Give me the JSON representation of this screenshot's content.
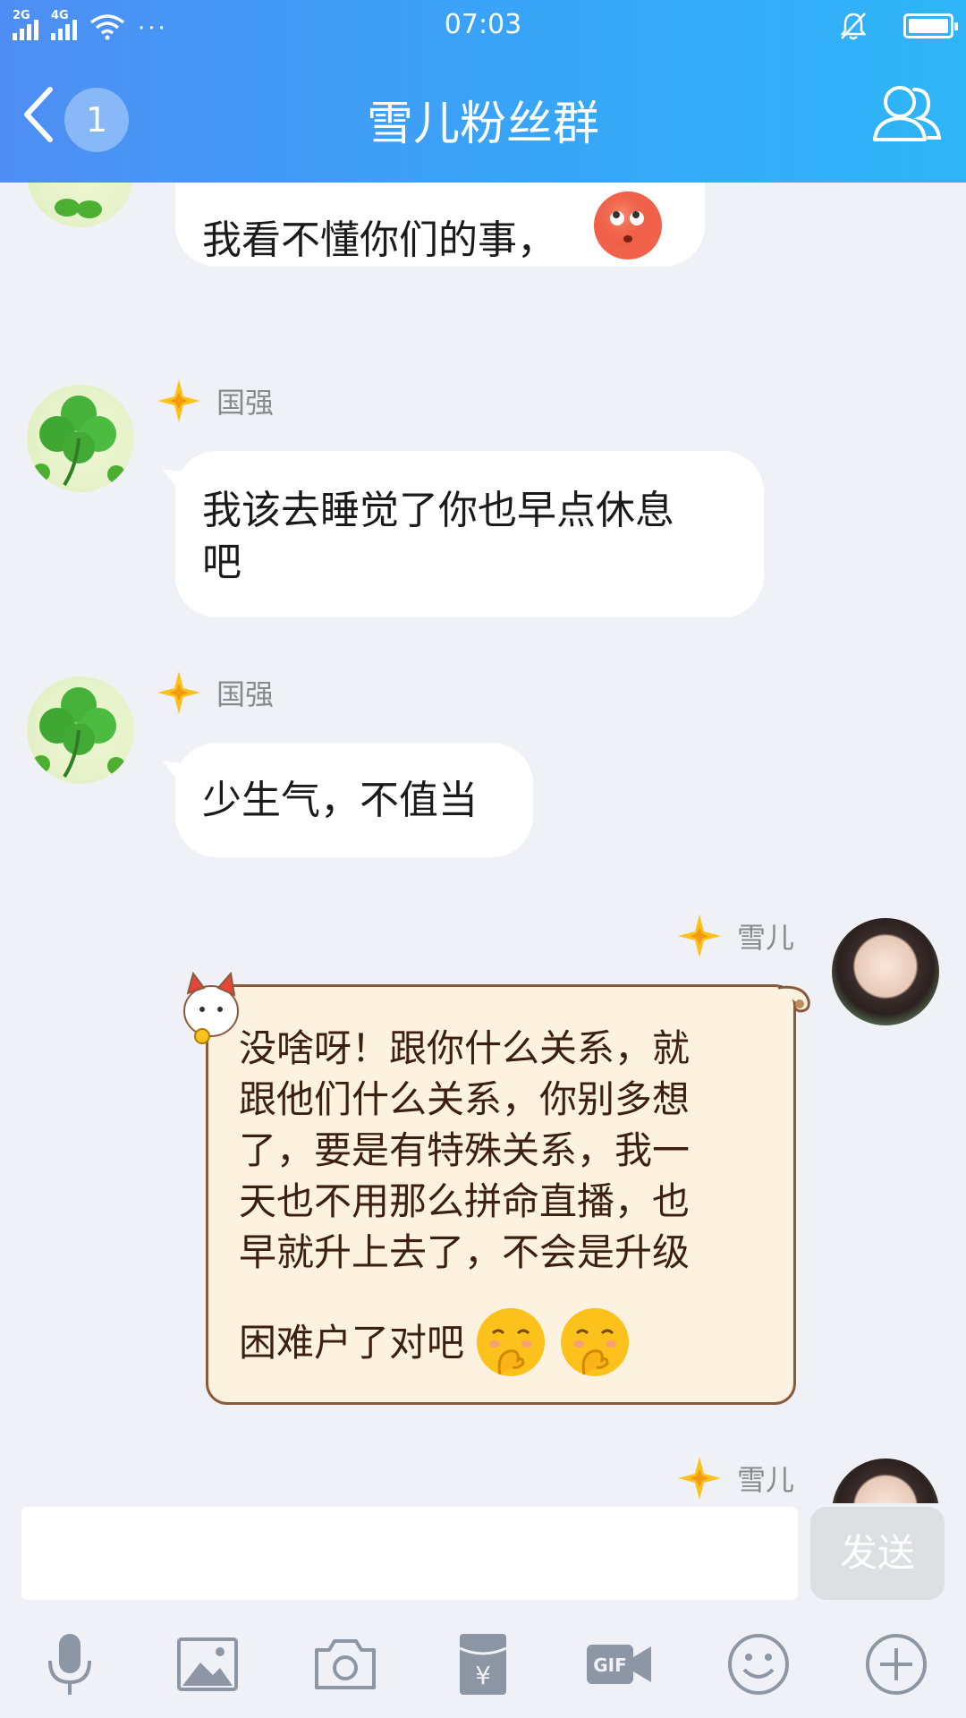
{
  "status_bar": {
    "net1": "2G",
    "net2": "4G",
    "time": "07:03",
    "more": "···"
  },
  "navbar": {
    "unread_count": "1",
    "title": "雪儿粉丝群"
  },
  "messages": [
    {
      "text": "我看不懂你们的事，",
      "emoji": "rolling-eyes-emoji"
    },
    {
      "sender": "国强",
      "text_line1": "我该去睡觉了你也早点休息",
      "text_line2": "吧"
    },
    {
      "sender": "国强",
      "text": "少生气，不值当"
    },
    {
      "sender": "雪儿",
      "lines": [
        "没啥呀！跟你什么关系，就",
        "跟他们什么关系，你别多想",
        "了，要是有特殊关系，我一",
        "天也不用那么拼命直播，也",
        "早就升上去了，不会是升级"
      ],
      "last_line": "困难户了对吧",
      "emoji": "shy-hand-over-mouth-emoji"
    },
    {
      "sender": "雪儿"
    }
  ],
  "input": {
    "value": "",
    "send_label": "发送"
  },
  "colors": {
    "header_start": "#4e8ef4",
    "header_end": "#2eb5f7",
    "chat_bg": "#f0f1f6",
    "scroll_bubble_bg": "#fdf1df",
    "scroll_text": "#3d1f0e"
  }
}
